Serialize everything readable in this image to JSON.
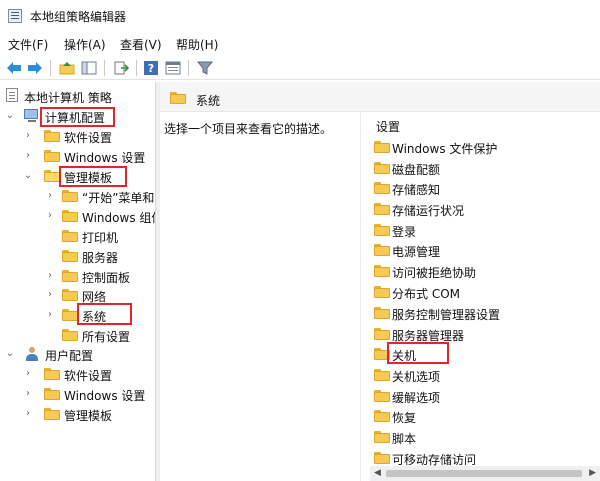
{
  "window": {
    "title": "本地组策略编辑器"
  },
  "menu": [
    "文件(F)",
    "操作(A)",
    "查看(V)",
    "帮助(H)"
  ],
  "toolbar_icons": [
    "back-arrow-icon",
    "forward-arrow-icon",
    "up-folder-icon",
    "show-hide-tree-icon",
    "export-list-icon",
    "help-icon",
    "properties-icon",
    "filter-icon"
  ],
  "tree": {
    "root": "本地计算机 策略",
    "computer_config": "计算机配置",
    "software_settings": "软件设置",
    "windows_settings": "Windows 设置",
    "admin_templates": "管理模板",
    "start_menu": "“开始”菜单和",
    "windows_components": "Windows 组件",
    "printers": "打印机",
    "server": "服务器",
    "control_panel": "控制面板",
    "network": "网络",
    "system": "系统",
    "all_settings": "所有设置",
    "user_config": "用户配置",
    "user_software_settings": "软件设置",
    "user_windows_settings": "Windows 设置",
    "user_admin_templates": "管理模板"
  },
  "right": {
    "header": "系统",
    "description": "选择一个项目来查看它的描述。",
    "column_header": "设置",
    "items": [
      "Windows 文件保护",
      "磁盘配额",
      "存储感知",
      "存储运行状况",
      "登录",
      "电源管理",
      "访问被拒绝协助",
      "分布式 COM",
      "服务控制管理器设置",
      "服务器管理器",
      "关机",
      "关机选项",
      "缓解选项",
      "恢复",
      "脚本",
      "可移动存储访问"
    ]
  },
  "colors": {
    "highlight_box": "#e0252b",
    "folder": "#f6cb55",
    "nav_arrow": "#2b8fd8"
  }
}
